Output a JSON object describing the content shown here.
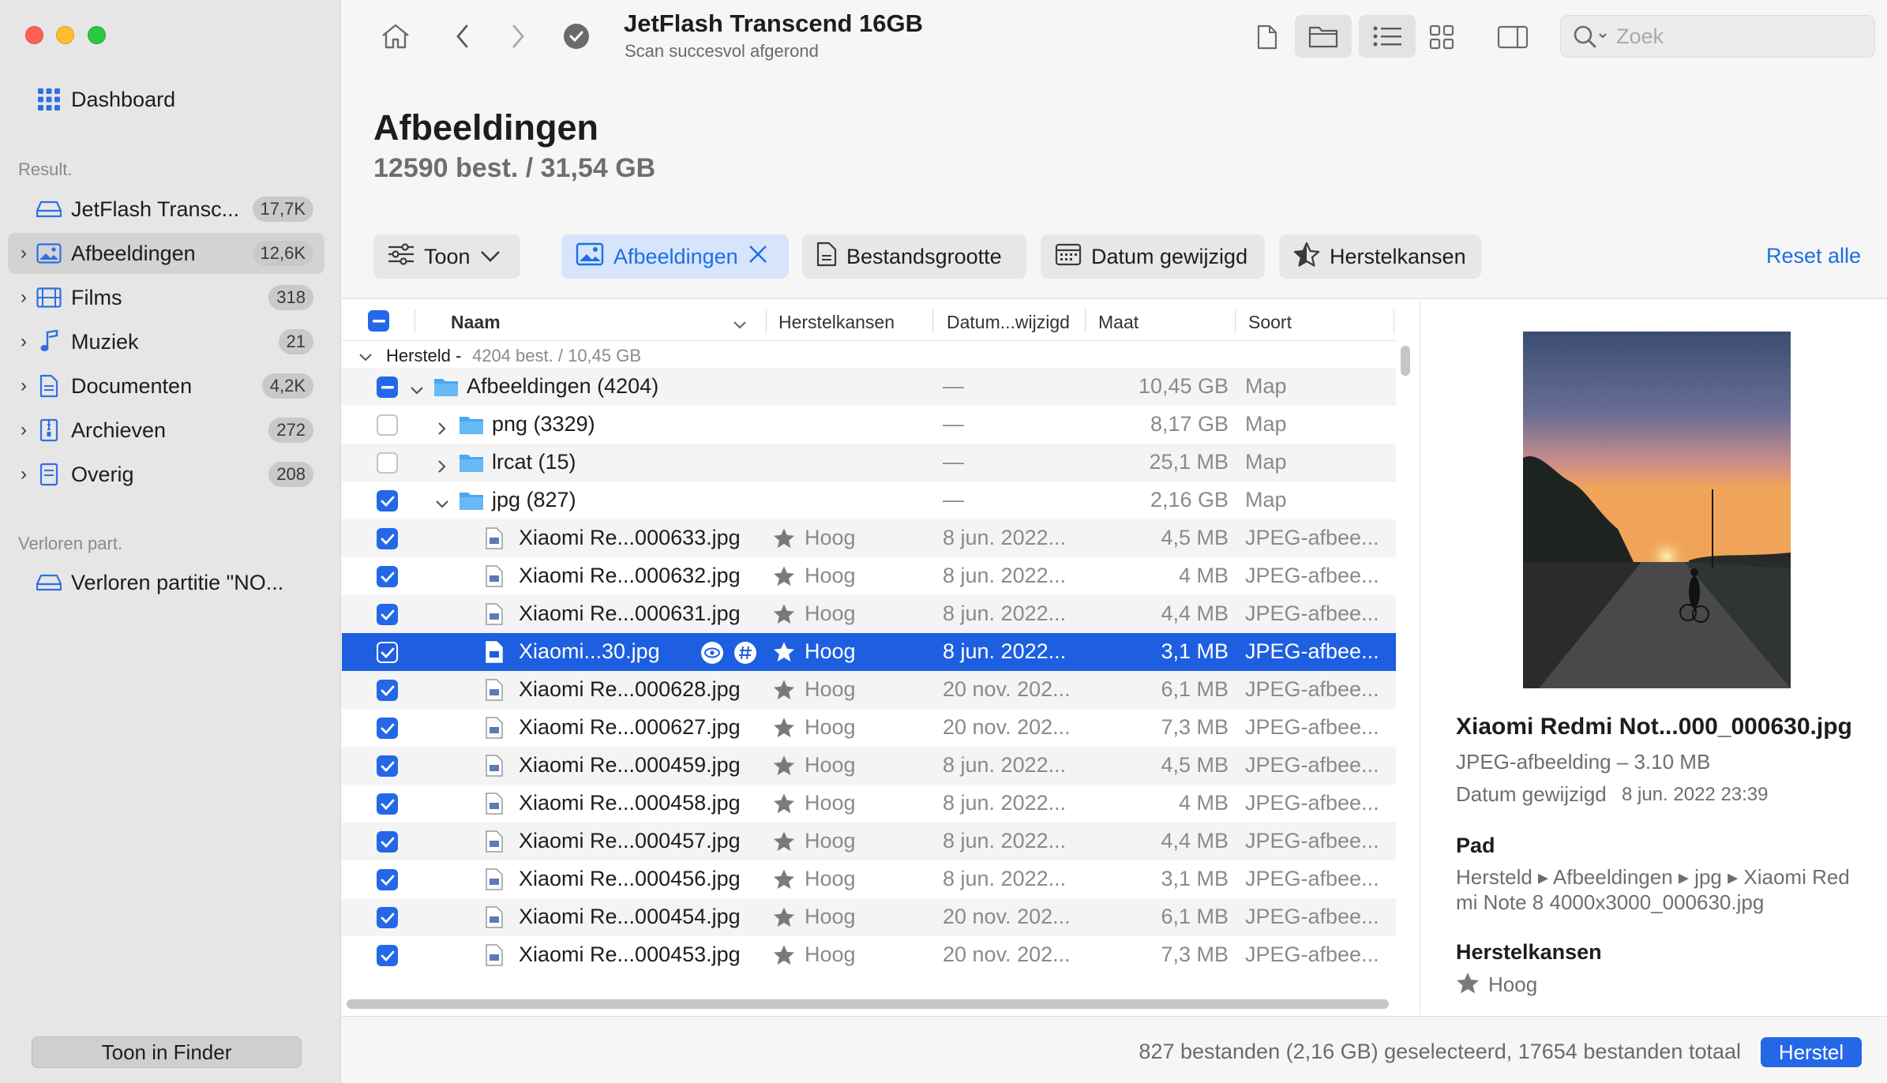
{
  "sidebar": {
    "dashboard_label": "Dashboard",
    "results_heading": "Result.",
    "items": [
      {
        "label": "JetFlash Transc...",
        "badge": "17,7K"
      },
      {
        "label": "Afbeeldingen",
        "badge": "12,6K"
      },
      {
        "label": "Films",
        "badge": "318"
      },
      {
        "label": "Muziek",
        "badge": "21"
      },
      {
        "label": "Documenten",
        "badge": "4,2K"
      },
      {
        "label": "Archieven",
        "badge": "272"
      },
      {
        "label": "Overig",
        "badge": "208"
      }
    ],
    "lost_heading": "Verloren part.",
    "lost_item": "Verloren partitie \"NO...",
    "finder_button": "Toon in Finder"
  },
  "toolbar": {
    "title": "JetFlash Transcend 16GB",
    "subtitle": "Scan succesvol afgerond",
    "search_placeholder": "Zoek"
  },
  "header": {
    "title": "Afbeeldingen",
    "count": "12590 best. / 31,54 GB",
    "filters": {
      "show": "Toon",
      "images": "Afbeeldingen",
      "size": "Bestandsgrootte",
      "date": "Datum gewijzigd",
      "chances": "Herstelkansen"
    },
    "reset_all": "Reset alle"
  },
  "table": {
    "columns": {
      "name": "Naam",
      "chances": "Herstelkansen",
      "date": "Datum...wijzigd",
      "size": "Maat",
      "kind": "Soort"
    },
    "group": {
      "label": "Hersteld -",
      "detail": "4204 best. / 10,45 GB"
    },
    "rows": [
      {
        "name": "Afbeeldingen (4204)",
        "chance": "",
        "date": "—",
        "size": "10,45 GB",
        "kind": "Map"
      },
      {
        "name": "png (3329)",
        "chance": "",
        "date": "—",
        "size": "8,17 GB",
        "kind": "Map"
      },
      {
        "name": "lrcat (15)",
        "chance": "",
        "date": "—",
        "size": "25,1 MB",
        "kind": "Map"
      },
      {
        "name": "jpg (827)",
        "chance": "",
        "date": "—",
        "size": "2,16 GB",
        "kind": "Map"
      },
      {
        "name": "Xiaomi Re...000633.jpg",
        "chance": "Hoog",
        "date": "8 jun. 2022...",
        "size": "4,5 MB",
        "kind": "JPEG-afbee..."
      },
      {
        "name": "Xiaomi Re...000632.jpg",
        "chance": "Hoog",
        "date": "8 jun. 2022...",
        "size": "4 MB",
        "kind": "JPEG-afbee..."
      },
      {
        "name": "Xiaomi Re...000631.jpg",
        "chance": "Hoog",
        "date": "8 jun. 2022...",
        "size": "4,4 MB",
        "kind": "JPEG-afbee..."
      },
      {
        "name": "Xiaomi...30.jpg",
        "chance": "Hoog",
        "date": "8 jun. 2022...",
        "size": "3,1 MB",
        "kind": "JPEG-afbee..."
      },
      {
        "name": "Xiaomi Re...000628.jpg",
        "chance": "Hoog",
        "date": "20 nov. 202...",
        "size": "6,1 MB",
        "kind": "JPEG-afbee..."
      },
      {
        "name": "Xiaomi Re...000627.jpg",
        "chance": "Hoog",
        "date": "20 nov. 202...",
        "size": "7,3 MB",
        "kind": "JPEG-afbee..."
      },
      {
        "name": "Xiaomi Re...000459.jpg",
        "chance": "Hoog",
        "date": "8 jun. 2022...",
        "size": "4,5 MB",
        "kind": "JPEG-afbee..."
      },
      {
        "name": "Xiaomi Re...000458.jpg",
        "chance": "Hoog",
        "date": "8 jun. 2022...",
        "size": "4 MB",
        "kind": "JPEG-afbee..."
      },
      {
        "name": "Xiaomi Re...000457.jpg",
        "chance": "Hoog",
        "date": "8 jun. 2022...",
        "size": "4,4 MB",
        "kind": "JPEG-afbee..."
      },
      {
        "name": "Xiaomi Re...000456.jpg",
        "chance": "Hoog",
        "date": "8 jun. 2022...",
        "size": "3,1 MB",
        "kind": "JPEG-afbee..."
      },
      {
        "name": "Xiaomi Re...000454.jpg",
        "chance": "Hoog",
        "date": "20 nov. 202...",
        "size": "6,1 MB",
        "kind": "JPEG-afbee..."
      },
      {
        "name": "Xiaomi Re...000453.jpg",
        "chance": "Hoog",
        "date": "20 nov. 202...",
        "size": "7,3 MB",
        "kind": "JPEG-afbee..."
      }
    ]
  },
  "preview": {
    "filename": "Xiaomi Redmi Not...000_000630.jpg",
    "type": "JPEG-afbeelding – 3.10 MB",
    "date_label": "Datum gewijzigd",
    "date_value": "8 jun. 2022 23:39",
    "path_heading": "Pad",
    "path_line1": "Hersteld ▸ Afbeeldingen ▸ jpg ▸ Xiaomi Red",
    "path_line2": "mi Note 8 4000x3000_000630.jpg",
    "chances_heading": "Herstelkansen",
    "chances_value": "Hoog"
  },
  "footer": {
    "status": "827 bestanden (2,16 GB) geselecteerd, 17654 bestanden totaal",
    "recover_button": "Herstel"
  },
  "colors": {
    "accent": "#2468e8",
    "selection": "#1d5fe0"
  }
}
